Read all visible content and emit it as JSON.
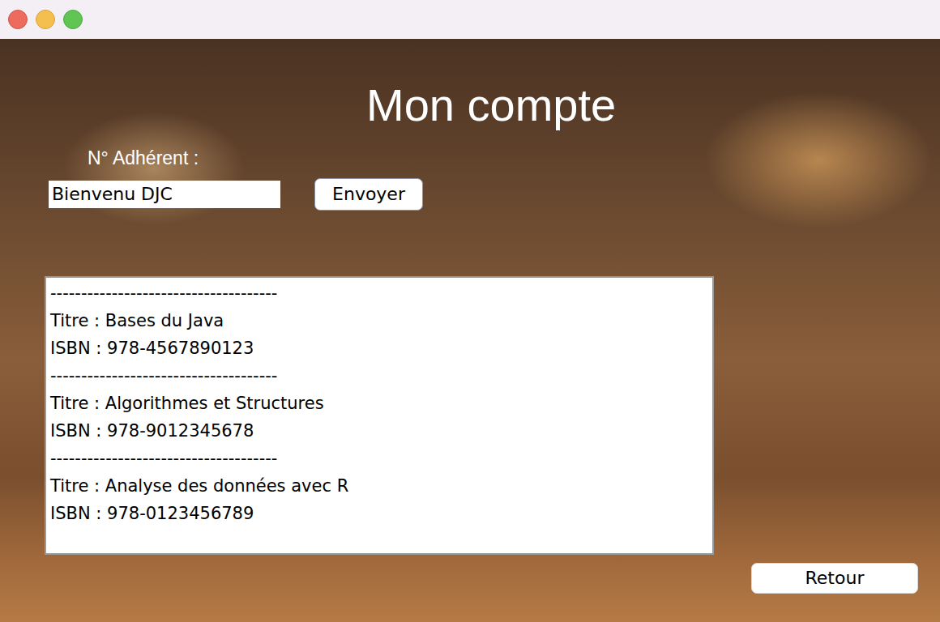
{
  "heading": "Mon compte",
  "member": {
    "label": "N° Adhérent :",
    "value": "Bienvenu DJC"
  },
  "buttons": {
    "send": "Envoyer",
    "back": "Retour"
  },
  "loans": [
    {
      "separator": "-------------------------------------",
      "title": "Titre : Bases du Java",
      "isbn": "ISBN : 978-4567890123"
    },
    {
      "separator": "-------------------------------------",
      "title": "Titre : Algorithmes et Structures",
      "isbn": "ISBN : 978-9012345678"
    },
    {
      "separator": "-------------------------------------",
      "title": "Titre : Analyse des données avec R",
      "isbn": "ISBN : 978-0123456789"
    }
  ]
}
